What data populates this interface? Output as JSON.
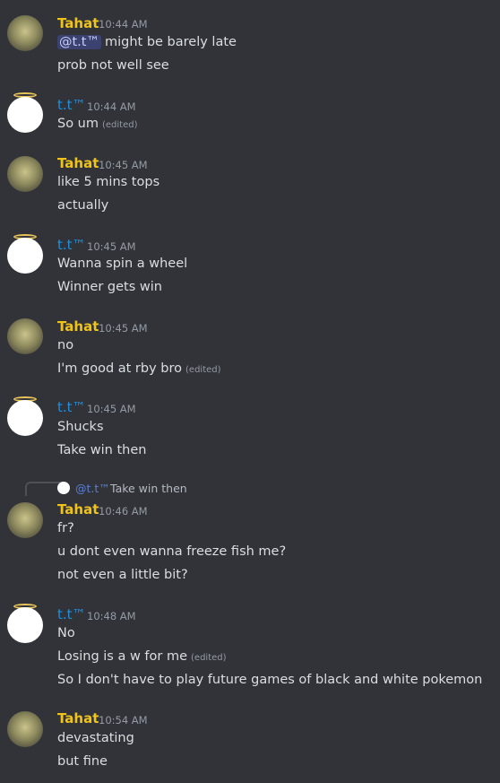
{
  "colors": {
    "background": "#313338",
    "tahat_name": "#f0c31a",
    "tt_name": "#1f8fdc",
    "text": "#dbdee1",
    "timestamp": "#949ba4",
    "mention_bg": "#3c4270"
  },
  "messages": [
    {
      "author": "Tahat",
      "time": "10:44 AM",
      "mention": "@t.t™",
      "lines": [
        "might be barely late",
        "prob not well see"
      ]
    },
    {
      "author": "t.t™",
      "time": "10:44 AM",
      "lines": [
        "So um"
      ],
      "edited": "(edited)"
    },
    {
      "author": "Tahat",
      "time": "10:45 AM",
      "lines": [
        "like 5 mins tops",
        "actually"
      ]
    },
    {
      "author": "t.t™",
      "time": "10:45 AM",
      "lines": [
        "Wanna spin a wheel",
        "Winner gets win"
      ]
    },
    {
      "author": "Tahat",
      "time": "10:45 AM",
      "lines": [
        "no",
        "I'm good at rby bro"
      ],
      "edited": "(edited)"
    },
    {
      "author": "t.t™",
      "time": "10:45 AM",
      "lines": [
        "Shucks",
        "Take win then"
      ]
    },
    {
      "reply_to": {
        "author": "@t.t™",
        "text": "Take win then"
      },
      "author": "Tahat",
      "time": "10:46 AM",
      "lines": [
        "fr?",
        "u dont even wanna freeze fish me?",
        "not even a little bit?"
      ]
    },
    {
      "author": "t.t™",
      "time": "10:48 AM",
      "lines": [
        "No",
        "Losing is a w for me",
        "So I don't have to play future games of black and white pokemon"
      ],
      "edited": "(edited)"
    },
    {
      "author": "Tahat",
      "time": "10:54 AM",
      "lines": [
        "devastating",
        "but fine"
      ]
    }
  ]
}
